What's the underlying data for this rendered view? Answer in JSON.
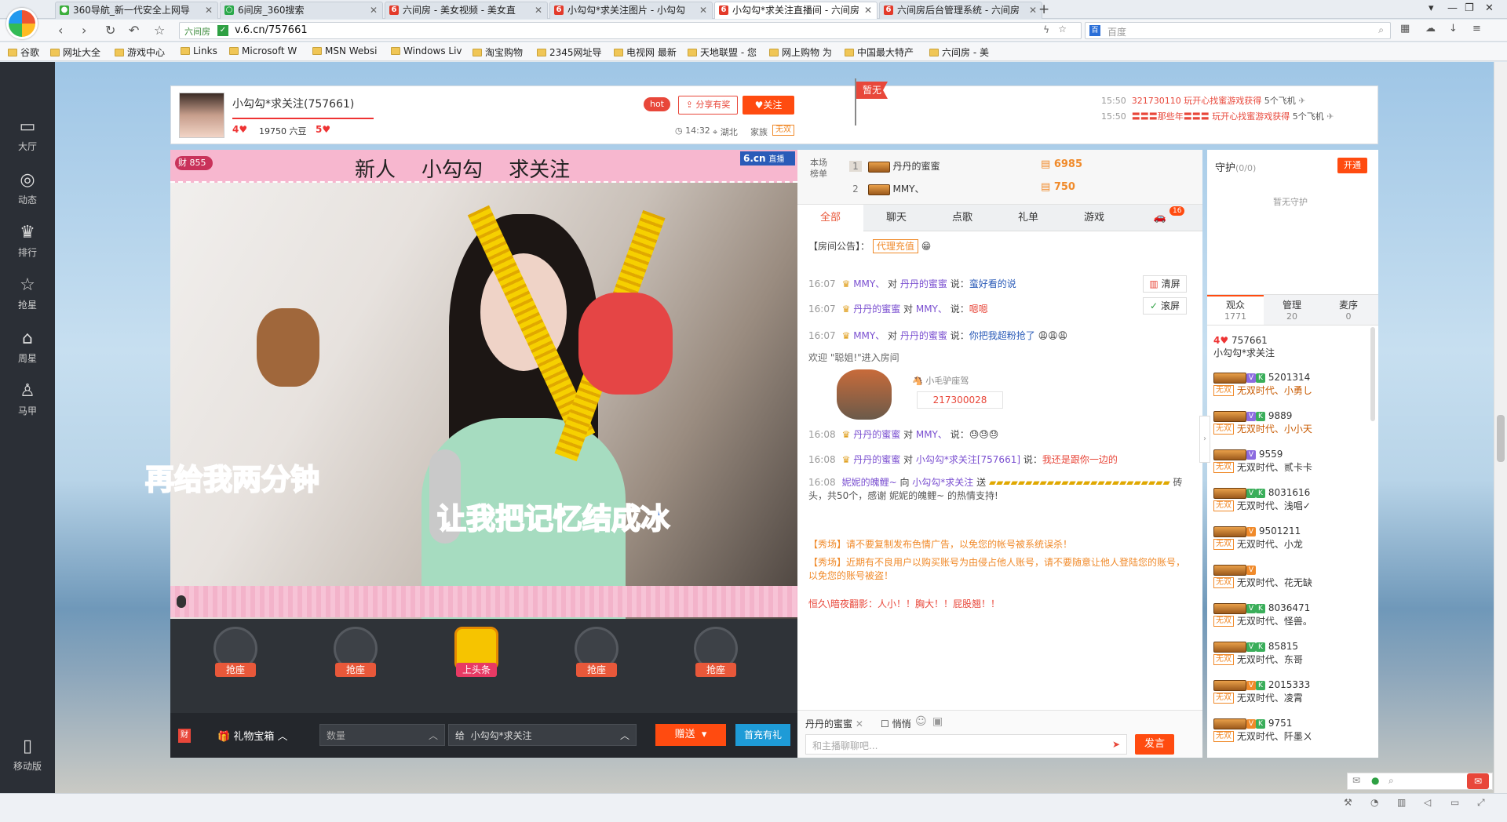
{
  "tabs": [
    {
      "label": "360导航_新一代安全上网导",
      "color": "#3cae3c",
      "active": false
    },
    {
      "label": "6间房_360搜索",
      "color": "#2aa84a",
      "active": false
    },
    {
      "label": "六间房 - 美女视频 - 美女直",
      "color": "#e33a2a",
      "active": false
    },
    {
      "label": "小勾勾*求关注图片 - 小勾勾",
      "color": "#e33a2a",
      "active": false
    },
    {
      "label": "小勾勾*求关注直播间 - 六间房",
      "color": "#e33a2a",
      "active": true
    },
    {
      "label": "六间房后台管理系统 - 六间房",
      "color": "#e33a2a",
      "active": false
    }
  ],
  "address": {
    "site_label": "六间房",
    "url": "v.6.cn/757661",
    "search_placeholder": "百度"
  },
  "bookmarks": [
    "谷歌",
    "网址大全",
    "游戏中心",
    "Links",
    "Microsoft W",
    "MSN Websi",
    "Windows Liv",
    "淘宝购物",
    "2345网址导",
    "电视网 最新",
    "天地联盟 - 您",
    "网上购物 为",
    "中国最大特产",
    "六间房 - 美"
  ],
  "leftnav": [
    {
      "label": "大厅",
      "icon": "tv-icon"
    },
    {
      "label": "动态",
      "icon": "compass-icon"
    },
    {
      "label": "排行",
      "icon": "crown-icon"
    },
    {
      "label": "抢星",
      "icon": "star-icon"
    },
    {
      "label": "周星",
      "icon": "gift-icon"
    },
    {
      "label": "马甲",
      "icon": "shirt-icon"
    },
    {
      "label": "移动版",
      "icon": "phone-icon"
    }
  ],
  "header": {
    "anchor_name": "小勾勾*求关注(757661)",
    "level_a": "4",
    "beans": "19750 六豆",
    "level_b": "5",
    "hot": "hot",
    "share": "分享有奖",
    "follow": "关注",
    "time": "14:32",
    "location": "湖北",
    "family_label": "家族",
    "family_value": "无双",
    "flag": "暂无",
    "news": [
      {
        "time": "15:50",
        "user": "321730110",
        "text": "玩开心找蜜游戏获得",
        "reward": "5个飞机"
      },
      {
        "time": "15:50",
        "user": "〓〓〓那些年〓〓〓",
        "text": "玩开心找蜜游戏获得",
        "reward": "5个飞机"
      }
    ]
  },
  "video": {
    "wealth": "855",
    "banner_title": "新人    小勾勾    求关注",
    "brand": "6.cn",
    "live": "直播",
    "lyric1": "再给我两分钟",
    "lyric2": "让我把记忆结成冰",
    "seats": [
      "抢座",
      "抢座",
      "上头条",
      "抢座",
      "抢座"
    ],
    "gift_box": "礼物宝箱",
    "qty_placeholder": "数量",
    "to_label": "给",
    "to_value": "小勾勾*求关注",
    "send": "赠送",
    "recharge": "首充有礼",
    "wealth_short": "财"
  },
  "rank": {
    "title": "本场榜单",
    "rows": [
      {
        "pos": "1",
        "name": "丹丹的蜜蜜",
        "score": "6985"
      },
      {
        "pos": "2",
        "name": "MMY、",
        "score": "750"
      }
    ]
  },
  "chat_tabs": [
    "全部",
    "聊天",
    "点歌",
    "礼单",
    "游戏"
  ],
  "chat_badge": "16",
  "notice": {
    "label": "【房间公告】：",
    "link": "代理充值"
  },
  "chat_tools": {
    "clear": "清屏",
    "scroll": "滚屏"
  },
  "messages": [
    {
      "time": "16:07",
      "from": "MMY、",
      "to": "丹丹的蜜蜜",
      "text": "蛮好看的说"
    },
    {
      "time": "16:07",
      "from": "丹丹的蜜蜜",
      "to": "MMY、",
      "text": "嗯嗯"
    },
    {
      "time": "16:07",
      "from": "MMY、",
      "to": "丹丹的蜜蜜",
      "text": "你把我超粉抢了"
    },
    {
      "time": "",
      "from": "",
      "to": "",
      "text": "欢迎 \"聪姐!\"进入房间"
    },
    {
      "time": "16:08",
      "from": "丹丹的蜜蜜",
      "to": "MMY、",
      "text": ""
    },
    {
      "time": "16:08",
      "from": "丹丹的蜜蜜",
      "to": "小勾勾*求关注[757661]",
      "text": "我还是跟你一边的"
    },
    {
      "time": "16:08",
      "from": "妮妮的魄鲤~",
      "to": "小勾勾*求关注",
      "text": "砖头，共50个，感谢 妮妮的魄鲤~ 的热情支持!"
    }
  ],
  "mount": {
    "label": "小毛驴座驾",
    "id": "217300028"
  },
  "system_msgs": [
    "【秀场】请不要复制发布色情广告，以免您的帐号被系统误杀！",
    "【秀场】近期有不良用户以购买账号为由侵占他人账号，请不要随意让他人登陆您的账号，以免您的账号被盗！"
  ],
  "last_msg": "恒久\\暗夜翻影：人小！！胸大！！屁股翘！！",
  "chat_input": {
    "target": "丹丹的蜜蜜",
    "whisper": "悄悄",
    "placeholder": "和主播聊聊吧...",
    "send": "发言"
  },
  "guard": {
    "title": "守护",
    "count": "(0/0)",
    "open": "开通",
    "empty": "暂无守护"
  },
  "audience_tabs": [
    {
      "label": "观众",
      "count": "1771"
    },
    {
      "label": "管理",
      "count": "20"
    },
    {
      "label": "麦序",
      "count": "0"
    }
  ],
  "audience": [
    {
      "id": "757661",
      "name": "小勾勾*求关注",
      "clan": "",
      "tag": ""
    },
    {
      "id": "5201314",
      "name": "小勇し",
      "clan": "无双时代、",
      "tag": "无双"
    },
    {
      "id": "9889",
      "name": "小小天",
      "clan": "无双时代、",
      "tag": "无双"
    },
    {
      "id": "9559",
      "name": "贰卡卡",
      "clan": "无双时代、",
      "tag": "无双"
    },
    {
      "id": "8031616",
      "name": "浅唱✓",
      "clan": "无双时代、",
      "tag": "无双"
    },
    {
      "id": "9501211",
      "name": "小龙",
      "clan": "无双时代、",
      "tag": "无双"
    },
    {
      "id": "",
      "name": "花无缺",
      "clan": "无双时代、",
      "tag": "无双"
    },
    {
      "id": "8036471",
      "name": "怪兽。",
      "clan": "无双时代、",
      "tag": "无双"
    },
    {
      "id": "85815",
      "name": "东哥",
      "clan": "无双时代、",
      "tag": "无双"
    },
    {
      "id": "2015333",
      "name": "凌霄",
      "clan": "无双时代、",
      "tag": "无双"
    },
    {
      "id": "9751",
      "name": "阡墨ㄨ",
      "clan": "无双时代、",
      "tag": "无双"
    }
  ]
}
